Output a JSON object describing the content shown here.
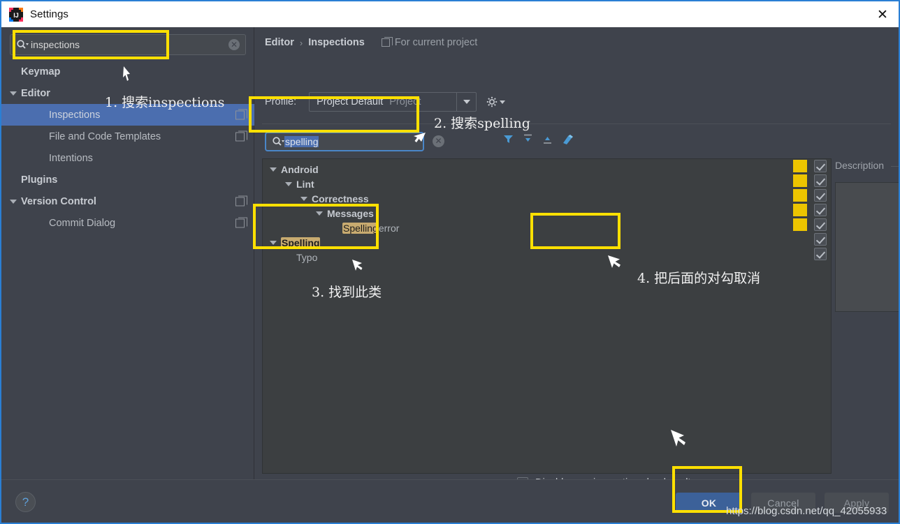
{
  "window": {
    "title": "Settings",
    "logo_icon": "intellij-idea-logo",
    "close_icon": "close-icon"
  },
  "sidebar": {
    "search": {
      "value": "inspections",
      "search_icon": "search-icon",
      "clear_icon": "clear-icon"
    },
    "items": [
      {
        "label": "Keymap",
        "indent": 0,
        "arrow": "none",
        "bold": true,
        "selected": false,
        "copy": false
      },
      {
        "label": "Editor",
        "indent": 0,
        "arrow": "down",
        "bold": true,
        "selected": false,
        "copy": false
      },
      {
        "label": "Inspections",
        "indent": 1,
        "arrow": "none",
        "bold": false,
        "selected": true,
        "copy": true
      },
      {
        "label": "File and Code Templates",
        "indent": 1,
        "arrow": "none",
        "bold": false,
        "selected": false,
        "copy": true
      },
      {
        "label": "Intentions",
        "indent": 1,
        "arrow": "none",
        "bold": false,
        "selected": false,
        "copy": false
      },
      {
        "label": "Plugins",
        "indent": 0,
        "arrow": "none",
        "bold": true,
        "selected": false,
        "copy": false
      },
      {
        "label": "Version Control",
        "indent": 0,
        "arrow": "down",
        "bold": true,
        "selected": false,
        "copy": true
      },
      {
        "label": "Commit Dialog",
        "indent": 1,
        "arrow": "none",
        "bold": false,
        "selected": false,
        "copy": true
      }
    ]
  },
  "main": {
    "breadcrumb": {
      "root": "Editor",
      "separator": "›",
      "leaf": "Inspections",
      "scope_label": "For current project",
      "scope_icon": "copy-icon"
    },
    "profile": {
      "label": "Profile:",
      "value": "Project Default",
      "suffix": "Project",
      "dropdown_icon": "chevron-down-icon",
      "gear_icon": "gear-icon"
    },
    "filter": {
      "search_value": "spelling",
      "search_icon": "search-icon",
      "clear_icon": "clear-icon",
      "icons": [
        "filter-icon",
        "expand-all-icon",
        "collapse-all-icon",
        "reset-icon"
      ]
    },
    "tree": [
      {
        "label": "Android",
        "indent": 0,
        "arrow": "down",
        "bold": true,
        "highlight": ""
      },
      {
        "label": "Lint",
        "indent": 1,
        "arrow": "down",
        "bold": true,
        "highlight": ""
      },
      {
        "label": "Correctness",
        "indent": 2,
        "arrow": "down",
        "bold": true,
        "highlight": ""
      },
      {
        "label": "Messages",
        "indent": 3,
        "arrow": "down",
        "bold": true,
        "highlight": ""
      },
      {
        "label": " error",
        "indent": 4,
        "arrow": "none",
        "bold": false,
        "highlight": "Spelling"
      },
      {
        "label": "",
        "indent": 0,
        "arrow": "down",
        "bold": true,
        "highlight": "Spelling"
      },
      {
        "label": "Typo",
        "indent": 1,
        "arrow": "none",
        "bold": false,
        "highlight": ""
      }
    ],
    "severity_swatch_count": 5,
    "severity_color": "#EDC500",
    "checkbox_count": 7,
    "disable_new": {
      "checked": false,
      "label": "Disable new inspections by default"
    }
  },
  "description": {
    "title": "Description",
    "content": ""
  },
  "footer": {
    "help_icon": "help-icon",
    "ok_label": "OK",
    "cancel_label": "Cancel",
    "apply_label": "Apply"
  },
  "annotations": {
    "step1": "1. 搜索inspections",
    "step2": "2. 搜索spelling",
    "step3": "3. 找到此类",
    "step4": "4. 把后面的对勾取消"
  },
  "watermark": "https://blog.csdn.net/qq_42055933",
  "colors": {
    "accent_blue": "#4B6EAF",
    "annotation_yellow": "#FFE000",
    "severity_yellow": "#EDC500",
    "highlight_tan": "#C8AB70",
    "dialog_bg": "#3F434C",
    "tree_bg": "#3C3F41"
  }
}
